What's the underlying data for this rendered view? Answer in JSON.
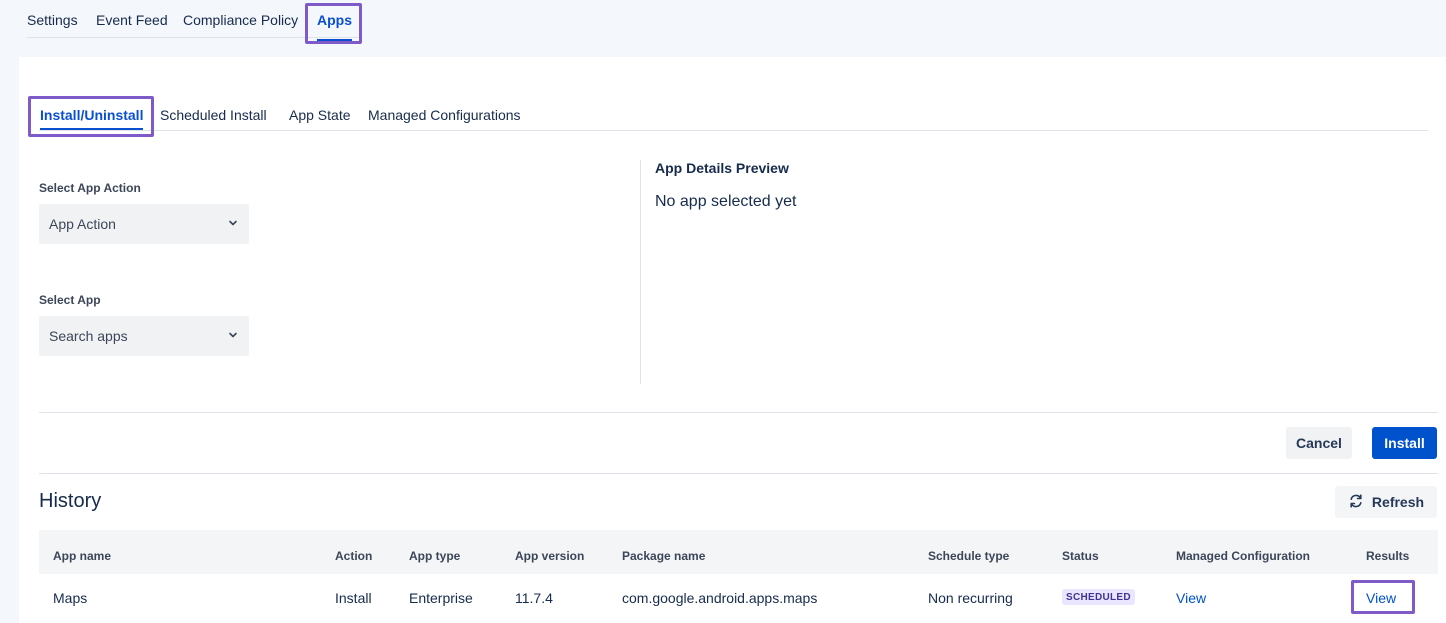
{
  "top_tabs": [
    {
      "label": "Settings"
    },
    {
      "label": "Event Feed"
    },
    {
      "label": "Compliance Policy"
    },
    {
      "label": "Apps",
      "active": true
    }
  ],
  "sub_tabs": [
    {
      "label": "Install/Uninstall",
      "active": true
    },
    {
      "label": "Scheduled Install"
    },
    {
      "label": "App State"
    },
    {
      "label": "Managed Configurations"
    }
  ],
  "form": {
    "app_action_label": "Select App Action",
    "app_action_value": "App Action",
    "app_label": "Select App",
    "app_value": "Search apps"
  },
  "preview": {
    "title": "App Details Preview",
    "empty_text": "No app selected yet"
  },
  "actions": {
    "cancel_label": "Cancel",
    "install_label": "Install"
  },
  "history": {
    "title": "History",
    "refresh_label": "Refresh",
    "columns": [
      "App name",
      "Action",
      "App type",
      "App version",
      "Package name",
      "Schedule type",
      "Status",
      "Managed Configuration",
      "Results"
    ],
    "rows": [
      {
        "app_name": "Maps",
        "action": "Install",
        "app_type": "Enterprise",
        "app_version": "11.7.4",
        "package_name": "com.google.android.apps.maps",
        "schedule_type": "Non recurring",
        "status": "SCHEDULED",
        "managed_configuration": "View",
        "results": "View"
      }
    ]
  },
  "colors": {
    "accent": "#0b4fd1",
    "primary_button": "#0052cc",
    "highlight": "#7e5bc8",
    "badge_bg": "#eae6ff",
    "badge_text": "#403294"
  },
  "icons": {
    "chevron": "chevron-down-icon",
    "refresh": "refresh-icon"
  }
}
